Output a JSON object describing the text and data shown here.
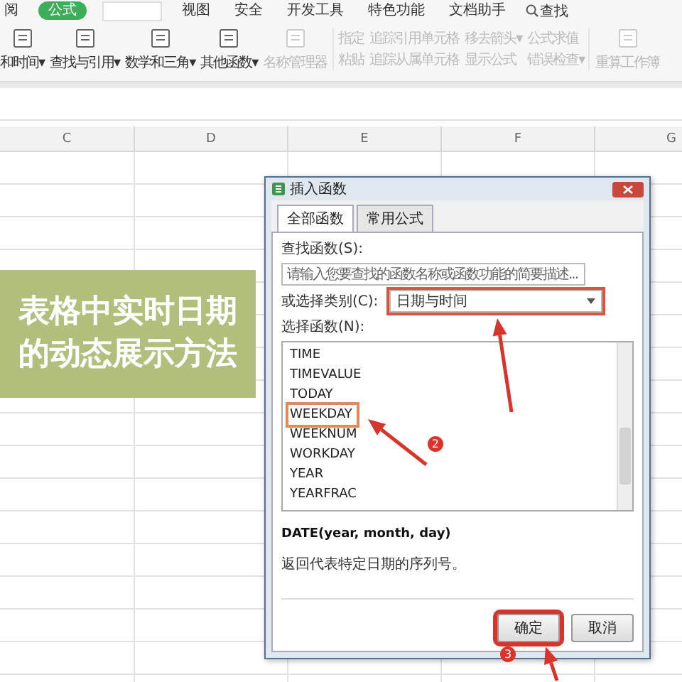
{
  "ribbon": {
    "tabs": [
      {
        "label": "阅",
        "selected": false
      },
      {
        "label": "公式",
        "selected": true
      },
      {
        "label": "视图",
        "selected": false
      },
      {
        "label": "安全",
        "selected": false
      },
      {
        "label": "开发工具",
        "selected": false
      },
      {
        "label": "特色功能",
        "selected": false
      },
      {
        "label": "文档助手",
        "selected": false
      }
    ],
    "search": "查找",
    "big_tools": [
      {
        "label": "和时间▾",
        "disabled": false
      },
      {
        "label": "查找与引用▾",
        "disabled": false
      },
      {
        "label": "数学和三角▾",
        "disabled": false
      },
      {
        "label": "其他函数▾",
        "disabled": false
      },
      {
        "label": "名称管理器",
        "disabled": true
      }
    ],
    "small_tools": [
      {
        "label": "指定",
        "disabled": true
      },
      {
        "label": "粘贴",
        "disabled": true
      },
      {
        "label": "追踪引用单元格",
        "disabled": true
      },
      {
        "label": "追踪从属单元格",
        "disabled": true
      },
      {
        "label": "移去箭头▾",
        "disabled": true
      },
      {
        "label": "显示公式",
        "disabled": true
      },
      {
        "label": "公式求值",
        "disabled": true
      },
      {
        "label": "错误检查▾",
        "disabled": true
      }
    ],
    "last_tool": {
      "label": "重算工作簿",
      "disabled": true
    }
  },
  "columns": [
    "C",
    "D",
    "E",
    "F",
    "G"
  ],
  "dialog": {
    "title": "插入函数",
    "tabs": [
      {
        "label": "全部函数",
        "selected": true
      },
      {
        "label": "常用公式",
        "selected": false
      }
    ],
    "search_label": "查找函数(S):",
    "search": {
      "placeholder": "请输入您要查找的函数名称或函数功能的简要描述..."
    },
    "category_label": "或选择类别(C):",
    "category": {
      "value": "日期与时间",
      "highlighted": true
    },
    "list_label": "选择函数(N):",
    "functions": [
      {
        "name": "TIME",
        "highlighted": false
      },
      {
        "name": "TIMEVALUE",
        "highlighted": false
      },
      {
        "name": "TODAY",
        "highlighted": false
      },
      {
        "name": "WEEKDAY",
        "highlighted": true,
        "step": "2"
      },
      {
        "name": "WEEKNUM",
        "highlighted": false
      },
      {
        "name": "WORKDAY",
        "highlighted": false
      },
      {
        "name": "YEAR",
        "highlighted": false
      },
      {
        "name": "YEARFRAC",
        "highlighted": false
      }
    ],
    "signature": "DATE(year, month, day)",
    "description": "返回代表特定日期的序列号。",
    "buttons": [
      {
        "label": "确定",
        "highlighted": true,
        "step": "3"
      },
      {
        "label": "取消",
        "highlighted": false
      }
    ]
  },
  "banner": {
    "title": "表格中实时日期的动态展示方法"
  }
}
